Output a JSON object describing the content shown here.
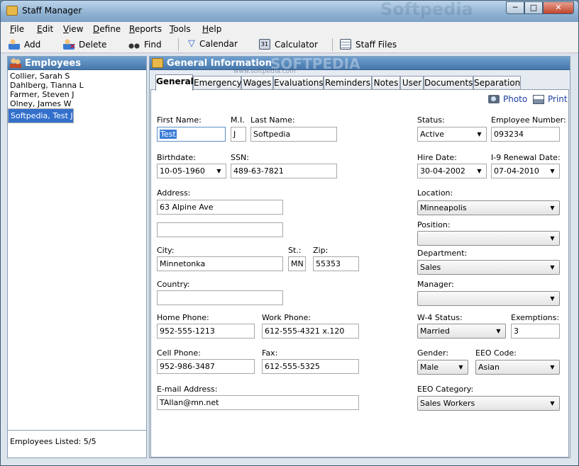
{
  "window": {
    "title": "Staff Manager",
    "controls": {
      "minimize": "─",
      "maximize": "□",
      "close": "✕"
    }
  },
  "watermark": {
    "title_text": "Softpedia",
    "panel_text": "SOFTPEDIA",
    "url_text": "www.softpedia.com"
  },
  "menu": [
    {
      "hotkey": "F",
      "rest": "ile"
    },
    {
      "hotkey": "E",
      "rest": "dit"
    },
    {
      "hotkey": "V",
      "rest": "iew"
    },
    {
      "hotkey": "D",
      "rest": "efine"
    },
    {
      "hotkey": "R",
      "rest": "eports"
    },
    {
      "hotkey": "T",
      "rest": "ools"
    },
    {
      "hotkey": "H",
      "rest": "elp"
    }
  ],
  "toolbar": {
    "add": "Add",
    "delete": "Delete",
    "find": "Find",
    "calendar": "Calendar",
    "calculator": "Calculator",
    "staff_files": "Staff Files"
  },
  "employees": {
    "header": "Employees",
    "items": [
      "Collier, Sarah S",
      "Dahlberg, Tianna L",
      "Farmer, Steven J",
      "Olney, James W",
      "Softpedia, Test J"
    ],
    "selected_index": 4,
    "listed": "Employees Listed: 5/5"
  },
  "general": {
    "header": "General Information",
    "tabs": [
      "General",
      "Emergency",
      "Wages",
      "Evaluations",
      "Reminders",
      "Notes",
      "User",
      "Documents",
      "Separation"
    ],
    "active_tab": "General",
    "photo_link": "Photo",
    "print_link": "Print",
    "labels": {
      "first_name": "First Name:",
      "mi": "M.I.",
      "last_name": "Last Name:",
      "birthdate": "Birthdate:",
      "ssn": "SSN:",
      "address": "Address:",
      "city": "City:",
      "st": "St.:",
      "zip": "Zip:",
      "country": "Country:",
      "home_phone": "Home Phone:",
      "work_phone": "Work Phone:",
      "cell_phone": "Cell Phone:",
      "fax": "Fax:",
      "email": "E-mail Address:",
      "status": "Status:",
      "employee_number": "Employee Number:",
      "hire_date": "Hire Date:",
      "i9_renewal": "I-9 Renewal Date:",
      "location": "Location:",
      "position": "Position:",
      "department": "Department:",
      "manager": "Manager:",
      "w4_status": "W-4 Status:",
      "exemptions": "Exemptions:",
      "gender": "Gender:",
      "eeo_code": "EEO Code:",
      "eeo_category": "EEO Category:"
    },
    "values": {
      "first_name": "Test",
      "mi": "J",
      "last_name": "Softpedia",
      "birthdate": "10-05-1960",
      "ssn": "489-63-7821",
      "address1": "63 Alpine Ave",
      "address2": "",
      "city": "Minnetonka",
      "st": "MN",
      "zip": "55353",
      "country": "",
      "home_phone": "952-555-1213",
      "work_phone": "612-555-4321 x.120",
      "cell_phone": "952-986-3487",
      "fax": "612-555-5325",
      "email": "TAllan@mn.net",
      "status": "Active",
      "employee_number": "093234",
      "hire_date": "30-04-2002",
      "i9_renewal": "07-04-2010",
      "location": "Minneapolis",
      "position": "",
      "department": "Sales",
      "manager": "",
      "w4_status": "Married",
      "exemptions": "3",
      "gender": "Male",
      "eeo_code": "Asian",
      "eeo_category": "Sales Workers"
    }
  },
  "colors": {
    "selection": "#3370cc",
    "pane_header": "#4677ab",
    "link": "#1a3d9e"
  },
  "icons": {
    "app": "folder-icon",
    "add": "add-person-icon",
    "delete": "delete-person-icon",
    "find": "binoculars-icon",
    "calendar": "filter-icon",
    "calculator": "calculator-icon",
    "staff_files": "grid-icon",
    "photo": "camera-icon",
    "print": "printer-icon"
  }
}
